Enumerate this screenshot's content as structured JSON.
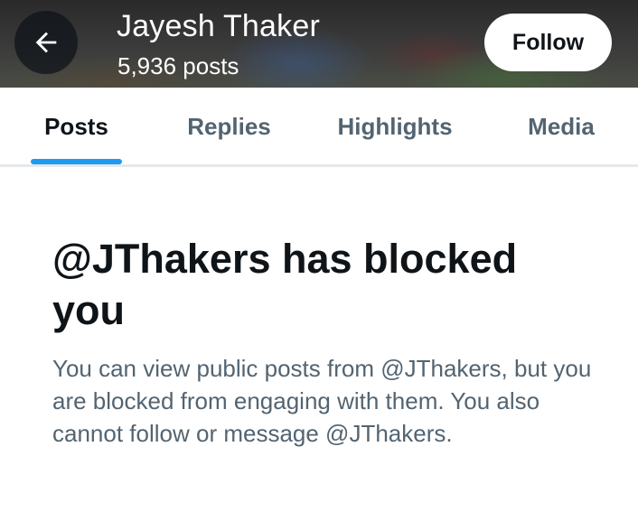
{
  "header": {
    "back_icon": "arrow-left-icon",
    "name": "Jayesh Thaker",
    "post_count": "5,936 posts",
    "follow_label": "Follow"
  },
  "tabs": [
    {
      "label": "Posts",
      "active": true
    },
    {
      "label": "Replies",
      "active": false
    },
    {
      "label": "Highlights",
      "active": false
    },
    {
      "label": "Media",
      "active": false
    }
  ],
  "blocked": {
    "title": "@JThakers has blocked you",
    "message": "You can view public posts from @JThakers, but you are blocked from engaging with them. You also cannot follow or message @JThakers."
  },
  "colors": {
    "accent": "#1d9bf0",
    "text_primary": "#0f1419",
    "text_secondary": "#536471"
  }
}
